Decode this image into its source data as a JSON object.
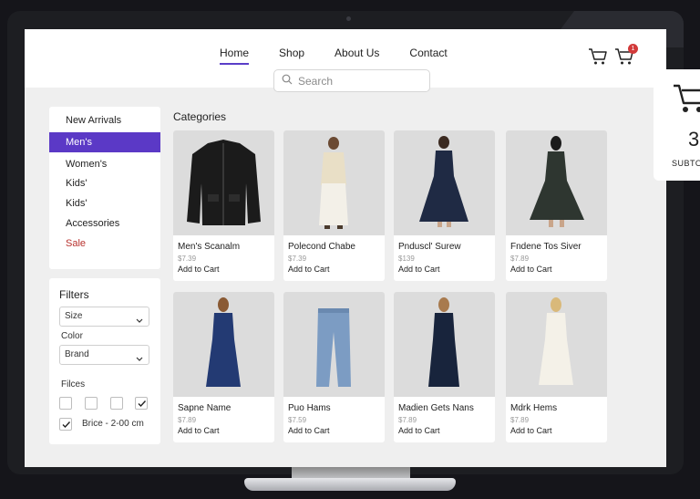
{
  "nav": {
    "items": [
      "Home",
      "Shop",
      "About Us",
      "Contact"
    ]
  },
  "search": {
    "placeholder": "Search"
  },
  "cart": {
    "badge": "1"
  },
  "sidebar": {
    "categories": [
      "New Arrivals",
      "Men's",
      "Women's",
      "Kids'",
      "Kids'",
      "Accessories",
      "Sale"
    ]
  },
  "filters": {
    "title": "Filters",
    "size_label": "Size",
    "color_label": "Color",
    "brand_label": "Brand",
    "fieces_label": "Filces",
    "price_label": "Brice - 2-00 cm"
  },
  "main": {
    "section_title": "Categories",
    "products": [
      {
        "name": "Men's Scanalm",
        "price": "$7.39",
        "cta": "Add to Cart"
      },
      {
        "name": "Polecond Chabe",
        "price": "$7.39",
        "cta": "Add to Cart"
      },
      {
        "name": "Pnduscl' Surew",
        "price": "$139",
        "cta": "Add to Cart"
      },
      {
        "name": "Fndene Tos Siver",
        "price": "$7.89",
        "cta": "Add to Cart"
      },
      {
        "name": "Sapne Name",
        "price": "$7.89",
        "cta": "Add to Cart"
      },
      {
        "name": "Puo Hams",
        "price": "$7.59",
        "cta": "Add to Cart"
      },
      {
        "name": "Madien Gets Nans",
        "price": "$7.89",
        "cta": "Add to Cart"
      },
      {
        "name": "Mdrk Hems",
        "price": "$7.89",
        "cta": "Add to Cart"
      }
    ]
  },
  "popup": {
    "count": "3",
    "subtotal_label": "SUBTO"
  },
  "colors": {
    "accent": "#5b39c6",
    "sale": "#b8322e",
    "badge": "#d23a3a"
  }
}
